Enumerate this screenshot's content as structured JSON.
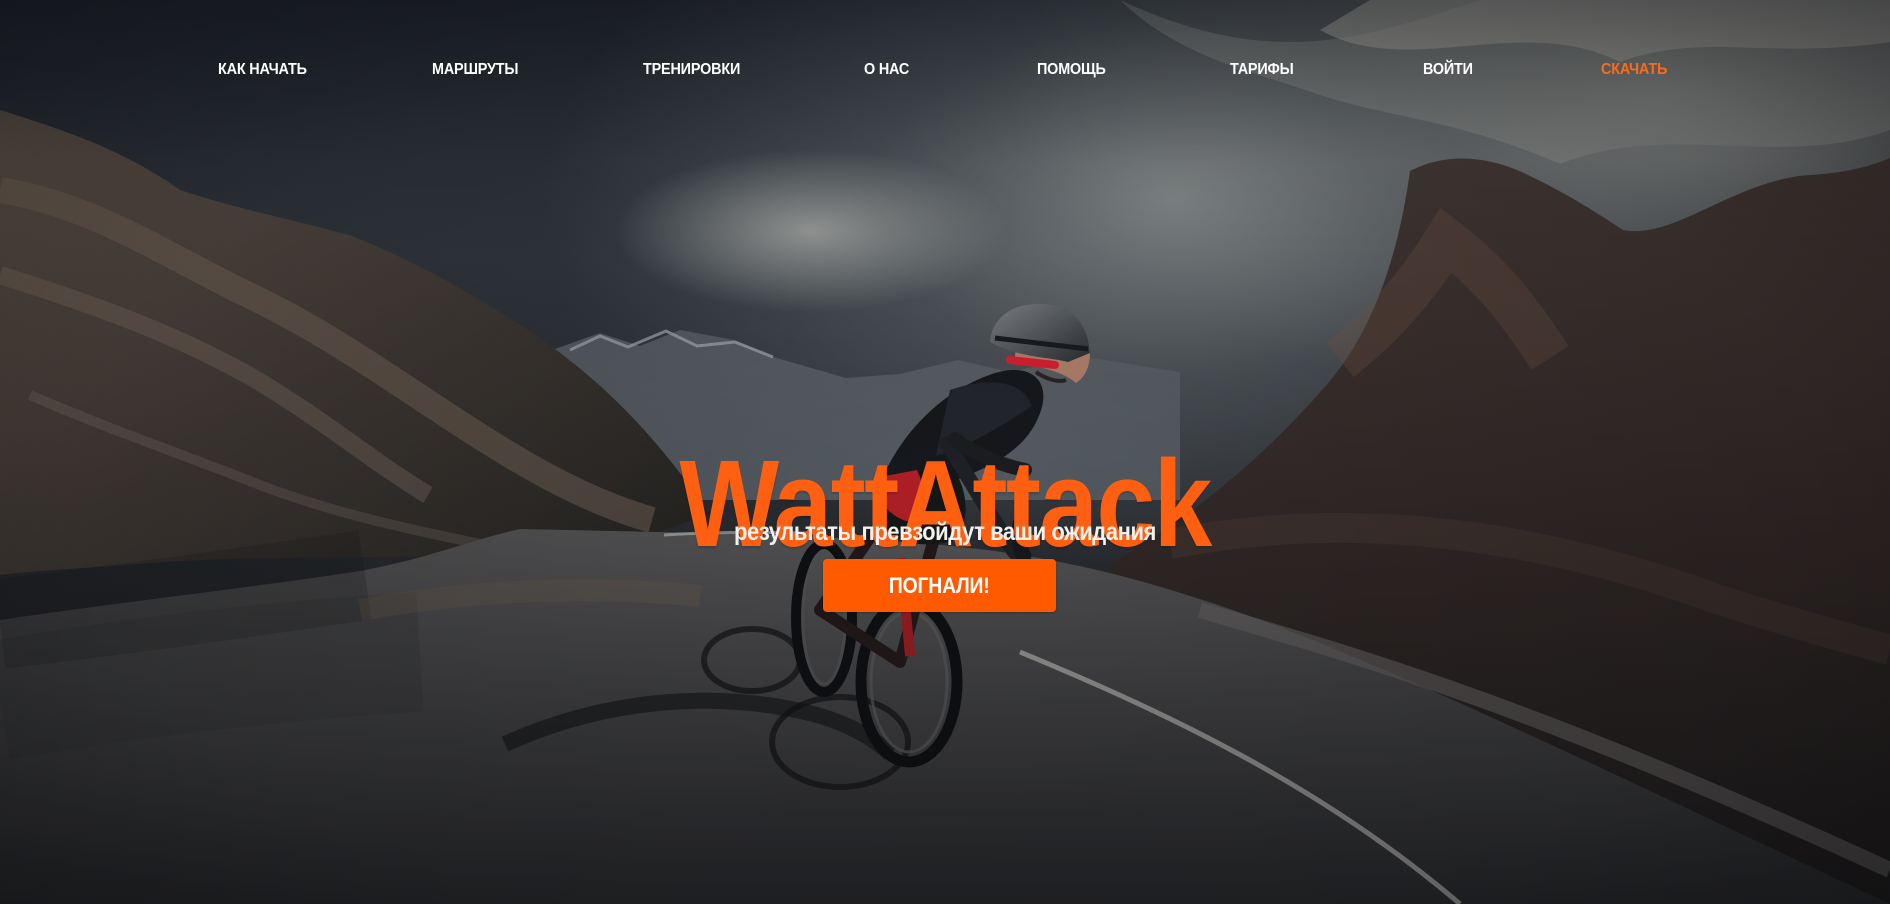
{
  "nav": {
    "items": [
      {
        "label": "КАК НАЧАТЬ"
      },
      {
        "label": "МАРШРУТЫ"
      },
      {
        "label": "ТРЕНИРОВКИ"
      },
      {
        "label": "О НАС"
      },
      {
        "label": "ПОМОЩЬ"
      },
      {
        "label": "ТАРИФЫ"
      },
      {
        "label": "ВОЙТИ"
      },
      {
        "label": "СКАЧАТЬ"
      }
    ]
  },
  "hero": {
    "title": "WattAttack",
    "subtitle": "результаты превзойдут ваши ожидания",
    "cta_label": "ПОГНАЛИ!"
  },
  "colors": {
    "accent": "#ff5f10",
    "nav_text": "#ffffff",
    "download_text": "#ff6a1a",
    "button": "#ff5a00"
  }
}
